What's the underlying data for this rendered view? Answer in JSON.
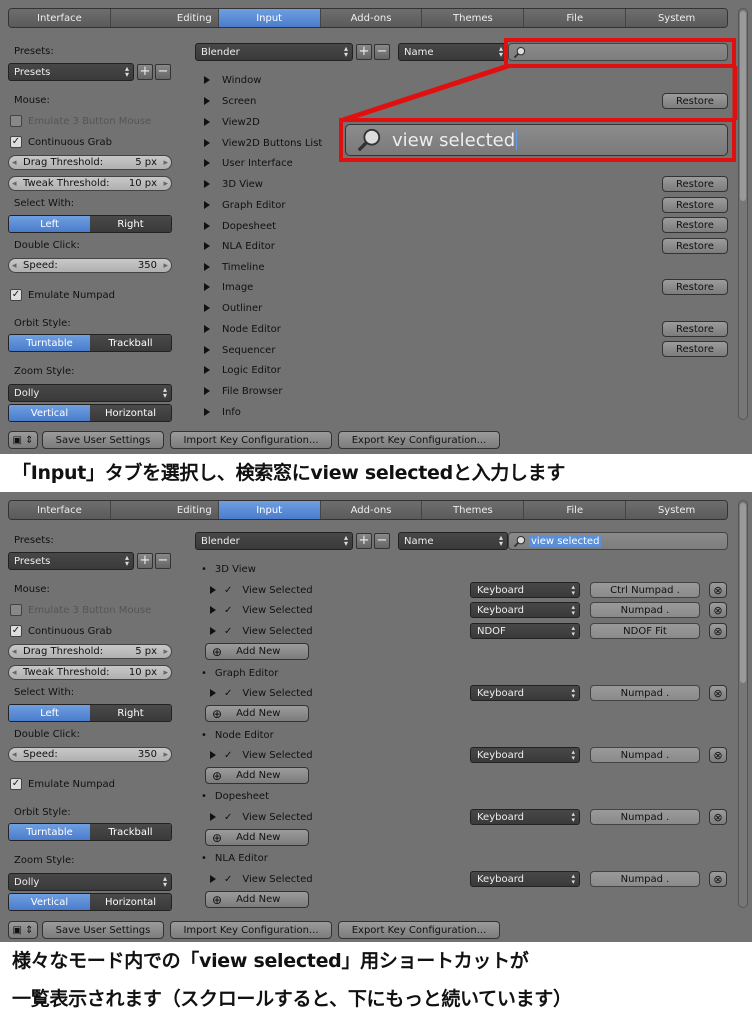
{
  "panel1": {
    "tabs": [
      "Interface",
      "Editing",
      "Input",
      "Add-ons",
      "Themes",
      "File",
      "System"
    ],
    "presets_label": "Presets:",
    "presets_value": "Presets",
    "mouse_label": "Mouse:",
    "emulate_3_button": "Emulate 3 Button Mouse",
    "continuous_grab": "Continuous Grab",
    "drag_threshold": {
      "label": "Drag Threshold:",
      "value": "5 px"
    },
    "tweak_threshold": {
      "label": "Tweak Threshold:",
      "value": "10 px"
    },
    "select_with_label": "Select With:",
    "select_with": [
      "Left",
      "Right"
    ],
    "double_click_label": "Double Click:",
    "speed": {
      "label": "Speed:",
      "value": "350"
    },
    "emulate_numpad": "Emulate Numpad",
    "orbit_style_label": "Orbit Style:",
    "orbit_style": [
      "Turntable",
      "Trackball"
    ],
    "zoom_style_label": "Zoom Style:",
    "zoom_style_value": "Dolly",
    "zoom_axis": [
      "Vertical",
      "Horizontal"
    ],
    "keymap_value": "Blender",
    "filter_type": "Name",
    "search_value": "",
    "zoomed_search_value": "view selected",
    "categories": [
      "Window",
      "Screen",
      "View2D",
      "View2D Buttons List",
      "User Interface",
      "3D View",
      "Graph Editor",
      "Dopesheet",
      "NLA Editor",
      "Timeline",
      "Image",
      "Outliner",
      "Node Editor",
      "Sequencer",
      "Logic Editor",
      "File Browser",
      "Info"
    ],
    "restore_label": "Restore",
    "bottom": {
      "save": "Save User Settings",
      "import": "Import Key Configuration...",
      "export": "Export Key Configuration..."
    }
  },
  "caption1": "「Input」タブを選択し、検索窓にview selectedと入力します",
  "panel2": {
    "search_value": "view selected",
    "sections": [
      {
        "name": "3D View",
        "items": [
          {
            "label": "View Selected",
            "type": "Keyboard",
            "key": "Ctrl Numpad ."
          },
          {
            "label": "View Selected",
            "type": "Keyboard",
            "key": "Numpad ."
          },
          {
            "label": "View Selected",
            "type": "NDOF",
            "key": "NDOF Fit"
          }
        ]
      },
      {
        "name": "Graph Editor",
        "items": [
          {
            "label": "View Selected",
            "type": "Keyboard",
            "key": "Numpad ."
          }
        ]
      },
      {
        "name": "Node Editor",
        "items": [
          {
            "label": "View Selected",
            "type": "Keyboard",
            "key": "Numpad ."
          }
        ]
      },
      {
        "name": "Dopesheet",
        "items": [
          {
            "label": "View Selected",
            "type": "Keyboard",
            "key": "Numpad ."
          }
        ]
      },
      {
        "name": "NLA Editor",
        "items": [
          {
            "label": "View Selected",
            "type": "Keyboard",
            "key": "Numpad ."
          }
        ]
      }
    ],
    "add_new": "Add New"
  },
  "caption2_line1": "様々なモード内での「view selected」用ショートカットが",
  "caption2_line2": "一覧表示されます（スクロールすると、下にもっと続いています）",
  "colors": {
    "accent": "#5b8fd8",
    "highlight": "#e01010",
    "panel_bg": "#727272"
  }
}
